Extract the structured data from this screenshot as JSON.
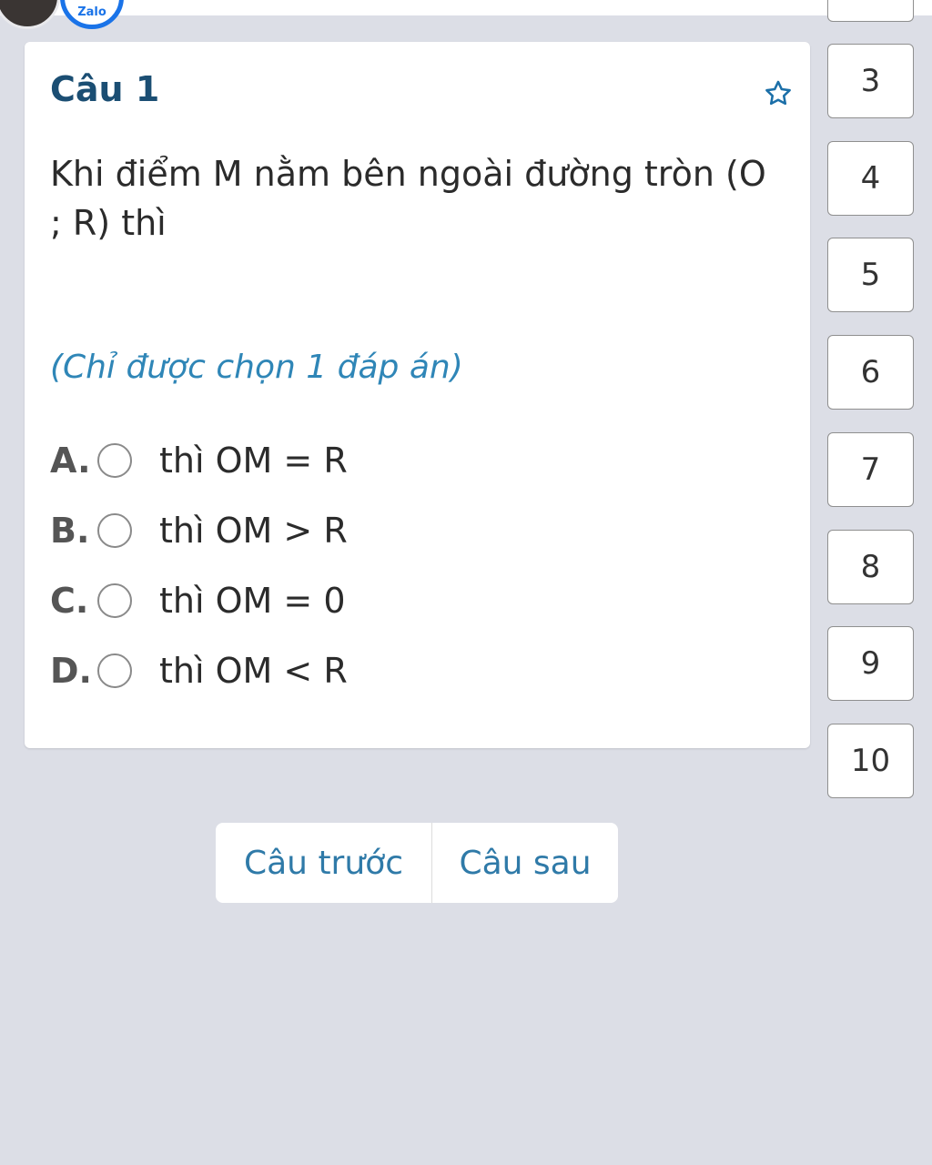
{
  "header": {
    "zalo_text": "Zalo"
  },
  "question": {
    "title": "Câu 1",
    "text": "Khi điểm M nằm bên ngoài đường tròn (O ; R) thì",
    "hint": "(Chỉ được chọn 1 đáp án)",
    "options": [
      {
        "letter": "A.",
        "text": "thì OM = R"
      },
      {
        "letter": "B.",
        "text": "thì OM > R"
      },
      {
        "letter": "C.",
        "text": "thì OM = 0"
      },
      {
        "letter": "D.",
        "text": "thì OM < R"
      }
    ]
  },
  "question_nav": [
    "3",
    "4",
    "5",
    "6",
    "7",
    "8",
    "9",
    "10"
  ],
  "buttons": {
    "prev": "Câu trước",
    "next": "Câu sau"
  },
  "colors": {
    "accent": "#2f86b7",
    "title": "#1b4e73",
    "background": "#dcdee6"
  }
}
